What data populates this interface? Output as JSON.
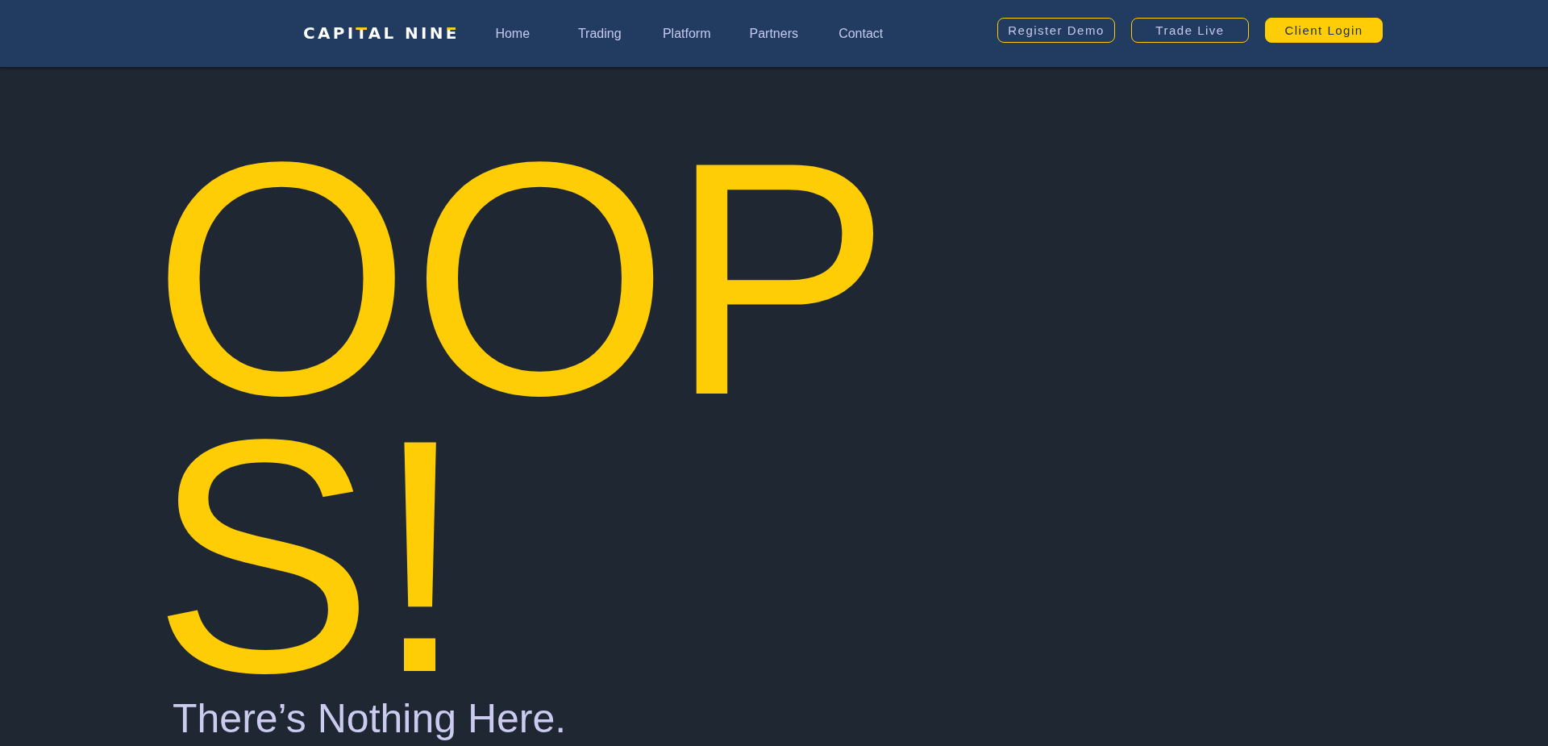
{
  "header": {
    "logo": "CAPITAL NINE",
    "nav": [
      "Home",
      "Trading",
      "Platform",
      "Partners",
      "Contact"
    ],
    "buttons": [
      {
        "label": "Register Demo",
        "kind": "outline"
      },
      {
        "label": "Trade Live",
        "kind": "outline"
      },
      {
        "label": "Client Login",
        "kind": "filled"
      }
    ]
  },
  "main": {
    "heading": "OOPS!",
    "message": "There’s Nothing Here."
  }
}
